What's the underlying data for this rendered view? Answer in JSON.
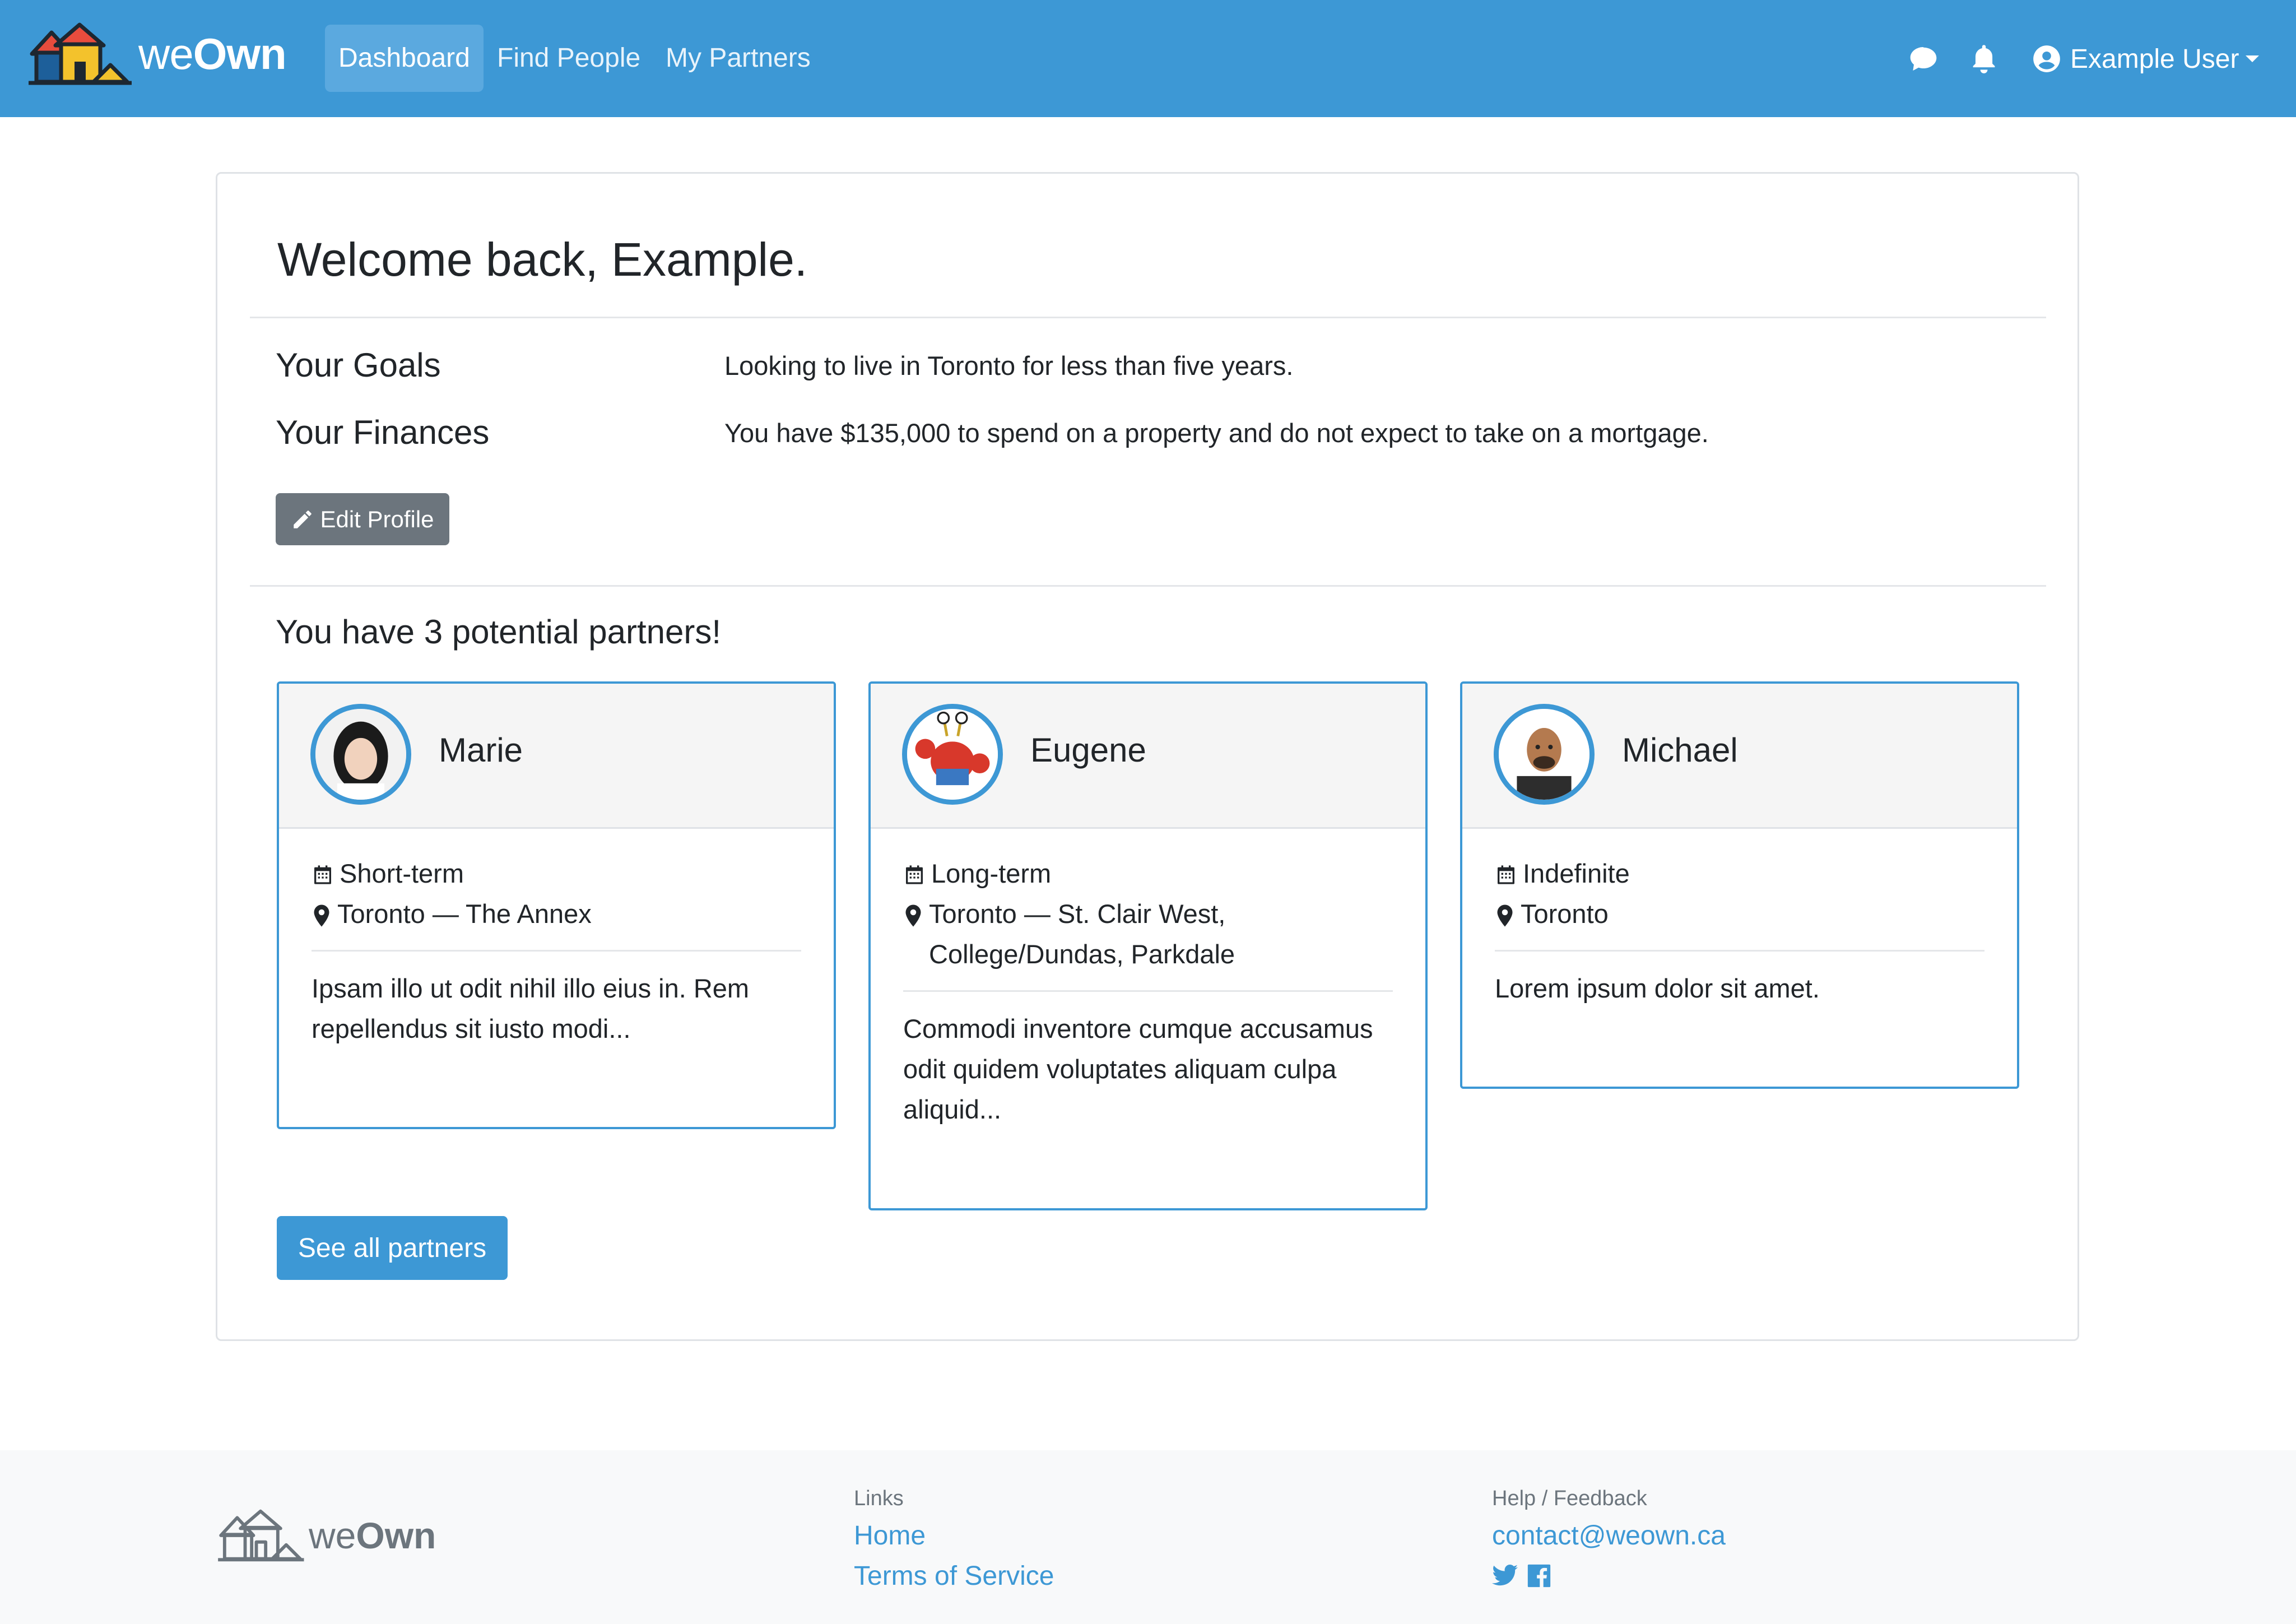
{
  "navbar": {
    "brand": {
      "light": "we",
      "bold": "Own"
    },
    "links": [
      "Dashboard",
      "Find People",
      "My Partners"
    ],
    "active_link": "Dashboard",
    "icons": [
      "chat-icon",
      "bell-icon",
      "user-circle-icon",
      "caret-down-icon"
    ],
    "user": "Example User"
  },
  "dashboard": {
    "welcome": "Welcome back, Example.",
    "goals_label": "Your Goals",
    "goals_text": "Looking to live in Toronto for less than five years.",
    "finances_label": "Your Finances",
    "finances_text": "You have $135,000 to spend on a property and do not expect to take on a mortgage.",
    "edit_button": "Edit Profile",
    "partners_title": "You have 3 potential partners!",
    "partners": [
      {
        "name": "Marie",
        "term": "Short-term",
        "location": "Toronto — The Annex",
        "description": "Ipsam illo ut odit nihil illo eius in. Rem repellendus sit iusto modi..."
      },
      {
        "name": "Eugene",
        "term": "Long-term",
        "location": "Toronto — St. Clair West, College/Dundas, Parkdale",
        "description": "Commodi inventore cumque accusamus odit quidem voluptates aliquam culpa aliquid..."
      },
      {
        "name": "Michael",
        "term": "Indefinite",
        "location": "Toronto",
        "description": "Lorem ipsum dolor sit amet."
      }
    ],
    "see_all_button": "See all partners"
  },
  "footer": {
    "brand": {
      "light": "we",
      "bold": "Own"
    },
    "links_heading": "Links",
    "links": [
      "Home",
      "Terms of Service"
    ],
    "help_heading": "Help / Feedback",
    "email": "contact@weown.ca",
    "social_icons": [
      "twitter-icon",
      "facebook-icon"
    ]
  },
  "colors": {
    "primary": "#3d98d5",
    "secondary": "#6c757d",
    "footer_bg": "#f8f9fa"
  }
}
